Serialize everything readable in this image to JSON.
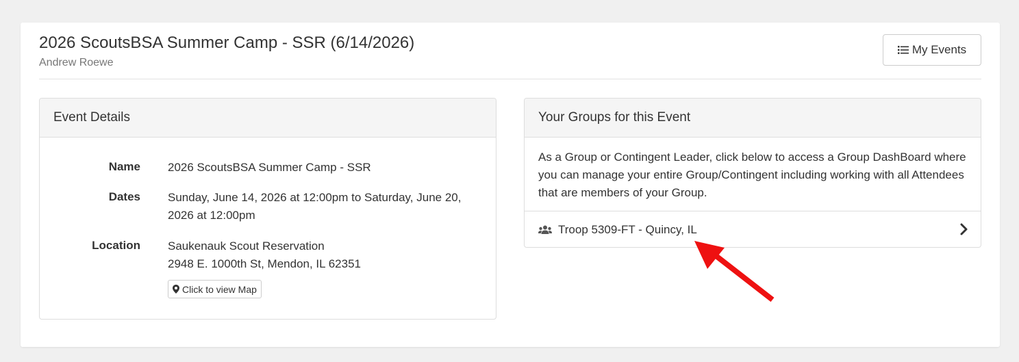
{
  "header": {
    "title": "2026 ScoutsBSA Summer Camp - SSR (6/14/2026)",
    "subtitle": "Andrew Roewe",
    "my_events_label": "My Events",
    "my_events_icon": "list-icon"
  },
  "event_details": {
    "heading": "Event Details",
    "name_label": "Name",
    "name_value": "2026 ScoutsBSA Summer Camp - SSR",
    "dates_label": "Dates",
    "dates_value": "Sunday, June 14, 2026 at 12:00pm to Saturday, June 20, 2026 at 12:00pm",
    "location_label": "Location",
    "location_line1": "Saukenauk Scout Reservation",
    "location_line2": "2948 E. 1000th St, Mendon, IL 62351",
    "map_button_label": "Click to view Map",
    "map_icon": "map-marker-icon"
  },
  "groups": {
    "heading": "Your Groups for this Event",
    "description": "As a Group or Contingent Leader, click below to access a Group DashBoard where you can manage your entire Group/Contingent including working with all Attendees that are members of your Group.",
    "items": [
      {
        "label": "Troop 5309-FT - Quincy, IL",
        "icon": "users-icon"
      }
    ]
  },
  "annotation": {
    "color": "#ee1111",
    "icon": "red-arrow-icon"
  }
}
